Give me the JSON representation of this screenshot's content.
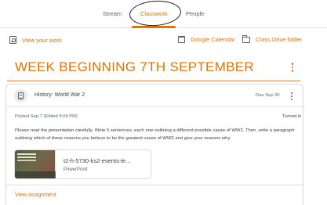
{
  "tabs": {
    "stream": "Stream",
    "classwork": "Classwork",
    "people": "People"
  },
  "toolbar": {
    "your_work": "View your work",
    "calendar": "Google Calendar",
    "drive": "Class Drive folder"
  },
  "topic": {
    "title": "WEEK BEGINNING 7TH SEPTEMBER"
  },
  "assignment": {
    "title": "History: World War 2",
    "due": "Due Sep 30",
    "posted": "Posted Sep 7 (Edited 9:09 PM)",
    "status": "Turned in",
    "instructions": "Please read the presentation carefully. Write 5 sentences, each one outlining a different possible cause of WW2. Then, write a paragraph outlining which of these reasons you believe to be the greatest cause of WW2 and give your reasons why.",
    "attachment": {
      "name": "t2-h-5730-ks2-events-le...",
      "type": "PowerPoint"
    },
    "view_link": "View assignment"
  },
  "colors": {
    "accent": "#e37400",
    "text": "#3c4043",
    "muted": "#5f6368"
  }
}
